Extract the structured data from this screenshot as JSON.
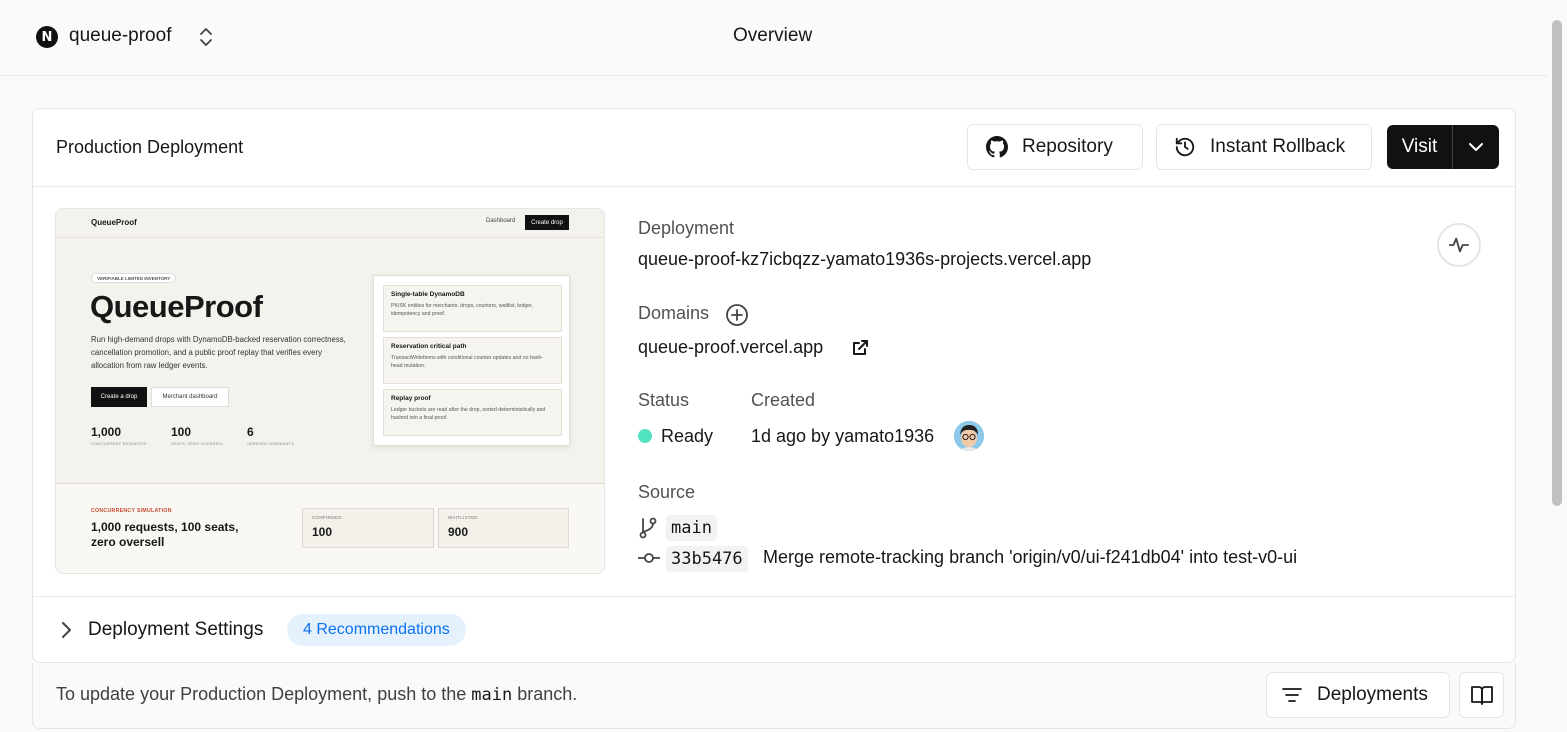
{
  "topbar": {
    "logo_letter": "N",
    "project_name": "queue-proof",
    "page_title": "Overview"
  },
  "card": {
    "title": "Production Deployment",
    "repository_label": "Repository",
    "rollback_label": "Instant Rollback",
    "visit_label": "Visit"
  },
  "preview": {
    "brand": "QueueProof",
    "nav_dashboard": "Dashboard",
    "nav_create": "Create drop",
    "badge": "VERIFIABLE LIMITED INVENTORY",
    "heading": "QueueProof",
    "description": "Run high-demand drops with DynamoDB-backed reservation correctness, cancellation promotion, and a public proof replay that verifies every allocation from raw ledger events.",
    "btn_create": "Create a drop",
    "btn_merchant": "Merchant dashboard",
    "stats": [
      {
        "num": "1,000",
        "label": "CONCURRENT REQUESTS"
      },
      {
        "num": "100",
        "label": "SEATS, ZERO OVERSELL"
      },
      {
        "num": "6",
        "label": "VERIFIED INVARIANTS"
      }
    ],
    "panel_items": [
      {
        "title": "Single-table DynamoDB",
        "desc": "PK/SK entities for merchants, drops, counters, waitlist, ledger, idempotency and proof."
      },
      {
        "title": "Reservation critical path",
        "desc": "TransactWriteItems with conditional counter updates and no hash-head mutation."
      },
      {
        "title": "Replay proof",
        "desc": "Ledger buckets are read after the drop, sorted deterministically and hashed into a final proof."
      }
    ],
    "sim_label": "CONCURRENCY SIMULATION",
    "sim_title": "1,000 requests, 100 seats, zero oversell",
    "boxes": [
      {
        "key": "CONFIRMED",
        "value": "100"
      },
      {
        "key": "WAITLISTED",
        "value": "900"
      }
    ]
  },
  "info": {
    "deployment_label": "Deployment",
    "deployment_url": "queue-proof-kz7icbqzz-yamato1936s-projects.vercel.app",
    "domains_label": "Domains",
    "domain": "queue-proof.vercel.app",
    "status_label": "Status",
    "status_value": "Ready",
    "status_color": "#50e3c2",
    "created_label": "Created",
    "created_value": "1d ago by yamato1936",
    "source_label": "Source",
    "branch": "main",
    "commit_hash": "33b5476",
    "commit_message": "Merge remote-tracking branch 'origin/v0/ui-f241db04' into test-v0-ui"
  },
  "settings": {
    "label": "Deployment Settings",
    "recommendations": "4 Recommendations"
  },
  "footer": {
    "text_before": "To update your Production Deployment, push to the",
    "branch": "main",
    "text_after": "branch.",
    "deployments_label": "Deployments"
  }
}
